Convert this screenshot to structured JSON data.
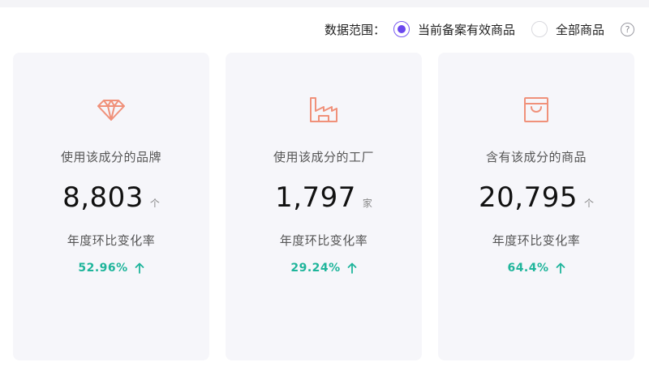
{
  "filter": {
    "label": "数据范围：",
    "options": [
      {
        "label": "当前备案有效商品",
        "selected": true
      },
      {
        "label": "全部商品",
        "selected": false
      }
    ],
    "help_icon": "?"
  },
  "cards": [
    {
      "icon": "diamond-icon",
      "title": "使用该成分的品牌",
      "value": "8,803",
      "unit": "个",
      "change_label": "年度环比变化率",
      "change_value": "52.96%",
      "trend": "up"
    },
    {
      "icon": "factory-icon",
      "title": "使用该成分的工厂",
      "value": "1,797",
      "unit": "家",
      "change_label": "年度环比变化率",
      "change_value": "29.24%",
      "trend": "up"
    },
    {
      "icon": "shopping-bag-icon",
      "title": "含有该成分的商品",
      "value": "20,795",
      "unit": "个",
      "change_label": "年度环比变化率",
      "change_value": "64.4%",
      "trend": "up"
    }
  ],
  "colors": {
    "accent": "#6b47ee",
    "trend_up": "#1fb59b",
    "icon": "#f0917a"
  }
}
